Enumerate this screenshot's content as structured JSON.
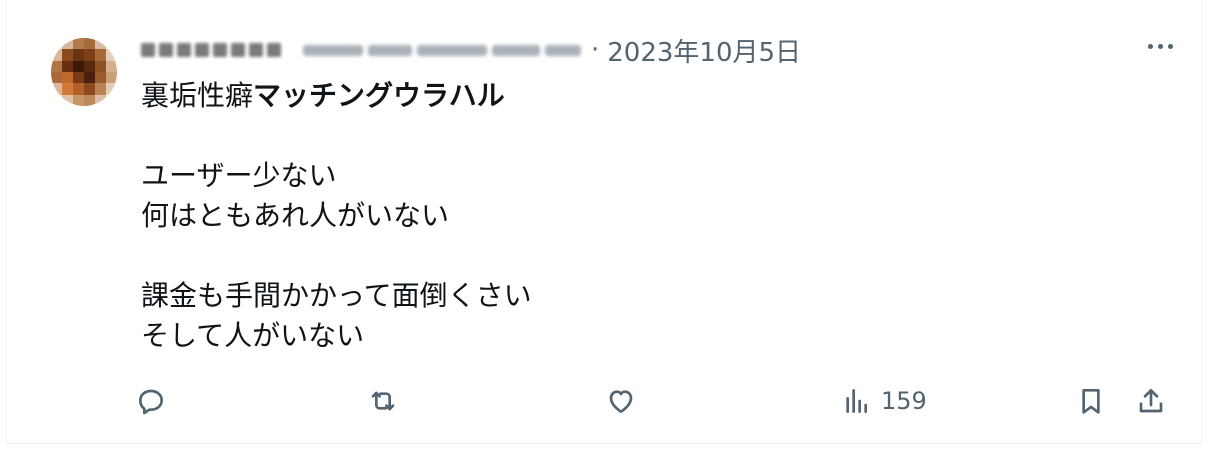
{
  "post": {
    "author_name": "",
    "author_handle": "",
    "separator": "·",
    "date": "2023年10月5日",
    "title_regular": "裏垢性癖",
    "title_bold": "マッチングウラハル",
    "lines": [
      "ユーザー少ない",
      "何はともあれ人がいない",
      "課金も手間かかって面倒くさい",
      "そして人がいない"
    ],
    "views": "159"
  },
  "icons": {
    "more": "more-icon",
    "reply": "reply-icon",
    "repost": "repost-icon",
    "like": "heart-icon",
    "views": "bar-chart-icon",
    "bookmark": "bookmark-icon",
    "share": "share-icon"
  },
  "colors": {
    "text": "#0f1419",
    "muted": "#536471",
    "border": "#eff3f4"
  }
}
